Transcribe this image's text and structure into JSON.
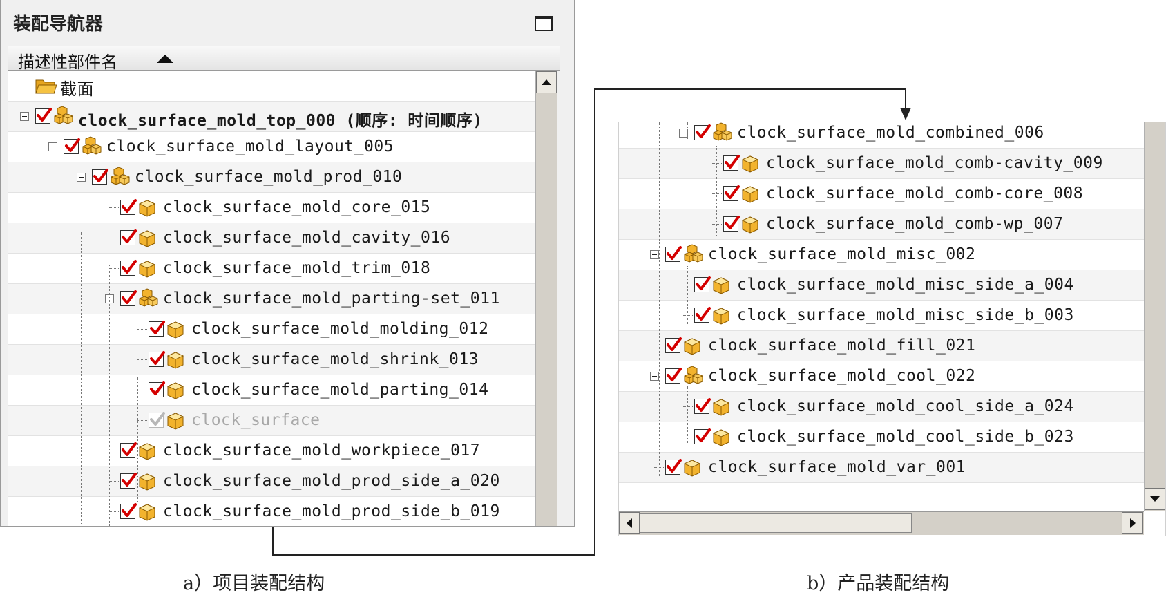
{
  "panel_a": {
    "title": "装配导航器",
    "column_header": "描述性部件名",
    "rows": [
      {
        "label": "截面",
        "kind": "folder",
        "checked": null,
        "level": 0,
        "bold": false,
        "dim": false
      },
      {
        "label": "clock_surface_mold_top_000 (顺序: 时间顺序)",
        "kind": "assembly",
        "checked": true,
        "level": 0,
        "bold": true,
        "dim": false,
        "expander": true
      },
      {
        "label": "clock_surface_mold_layout_005",
        "kind": "assembly",
        "checked": true,
        "level": 1,
        "bold": false,
        "dim": false,
        "expander": true
      },
      {
        "label": "clock_surface_mold_prod_010",
        "kind": "assembly",
        "checked": true,
        "level": 2,
        "bold": false,
        "dim": false,
        "expander": true
      },
      {
        "label": "clock_surface_mold_core_015",
        "kind": "part",
        "checked": true,
        "level": 3,
        "bold": false,
        "dim": false
      },
      {
        "label": "clock_surface_mold_cavity_016",
        "kind": "part",
        "checked": true,
        "level": 3,
        "bold": false,
        "dim": false
      },
      {
        "label": "clock_surface_mold_trim_018",
        "kind": "part",
        "checked": true,
        "level": 3,
        "bold": false,
        "dim": false
      },
      {
        "label": "clock_surface_mold_parting-set_011",
        "kind": "assembly",
        "checked": true,
        "level": 3,
        "bold": false,
        "dim": false,
        "expander": true
      },
      {
        "label": "clock_surface_mold_molding_012",
        "kind": "part",
        "checked": true,
        "level": 4,
        "bold": false,
        "dim": false
      },
      {
        "label": "clock_surface_mold_shrink_013",
        "kind": "part",
        "checked": true,
        "level": 4,
        "bold": false,
        "dim": false
      },
      {
        "label": "clock_surface_mold_parting_014",
        "kind": "part",
        "checked": true,
        "level": 4,
        "bold": false,
        "dim": false
      },
      {
        "label": "clock_surface",
        "kind": "part",
        "checked": true,
        "level": 4,
        "bold": false,
        "dim": true
      },
      {
        "label": "clock_surface_mold_workpiece_017",
        "kind": "part",
        "checked": true,
        "level": 3,
        "bold": false,
        "dim": false
      },
      {
        "label": "clock_surface_mold_prod_side_a_020",
        "kind": "part",
        "checked": true,
        "level": 3,
        "bold": false,
        "dim": false
      },
      {
        "label": "clock_surface_mold_prod_side_b_019",
        "kind": "part",
        "checked": true,
        "level": 3,
        "bold": false,
        "dim": false
      }
    ]
  },
  "panel_b": {
    "rows": [
      {
        "label": "clock_surface_mold_combined_006",
        "kind": "assembly",
        "checked": true,
        "level": 2,
        "expander": true
      },
      {
        "label": "clock_surface_mold_comb-cavity_009",
        "kind": "part",
        "checked": true,
        "level": 3
      },
      {
        "label": "clock_surface_mold_comb-core_008",
        "kind": "part",
        "checked": true,
        "level": 3
      },
      {
        "label": "clock_surface_mold_comb-wp_007",
        "kind": "part",
        "checked": true,
        "level": 3
      },
      {
        "label": "clock_surface_mold_misc_002",
        "kind": "assembly",
        "checked": true,
        "level": 1,
        "expander": true
      },
      {
        "label": "clock_surface_mold_misc_side_a_004",
        "kind": "part",
        "checked": true,
        "level": 2
      },
      {
        "label": "clock_surface_mold_misc_side_b_003",
        "kind": "part",
        "checked": true,
        "level": 2
      },
      {
        "label": "clock_surface_mold_fill_021",
        "kind": "part",
        "checked": true,
        "level": 1
      },
      {
        "label": "clock_surface_mold_cool_022",
        "kind": "assembly",
        "checked": true,
        "level": 1,
        "expander": true
      },
      {
        "label": "clock_surface_mold_cool_side_a_024",
        "kind": "part",
        "checked": true,
        "level": 2
      },
      {
        "label": "clock_surface_mold_cool_side_b_023",
        "kind": "part",
        "checked": true,
        "level": 2
      },
      {
        "label": "clock_surface_mold_var_001",
        "kind": "part",
        "checked": true,
        "level": 1
      }
    ]
  },
  "captions": {
    "a": "a）项目装配结构",
    "b": "b）产品装配结构"
  },
  "colors": {
    "check_red": "#d40000",
    "part_gold": "#f2b32e",
    "folder_gold": "#f5c242"
  }
}
